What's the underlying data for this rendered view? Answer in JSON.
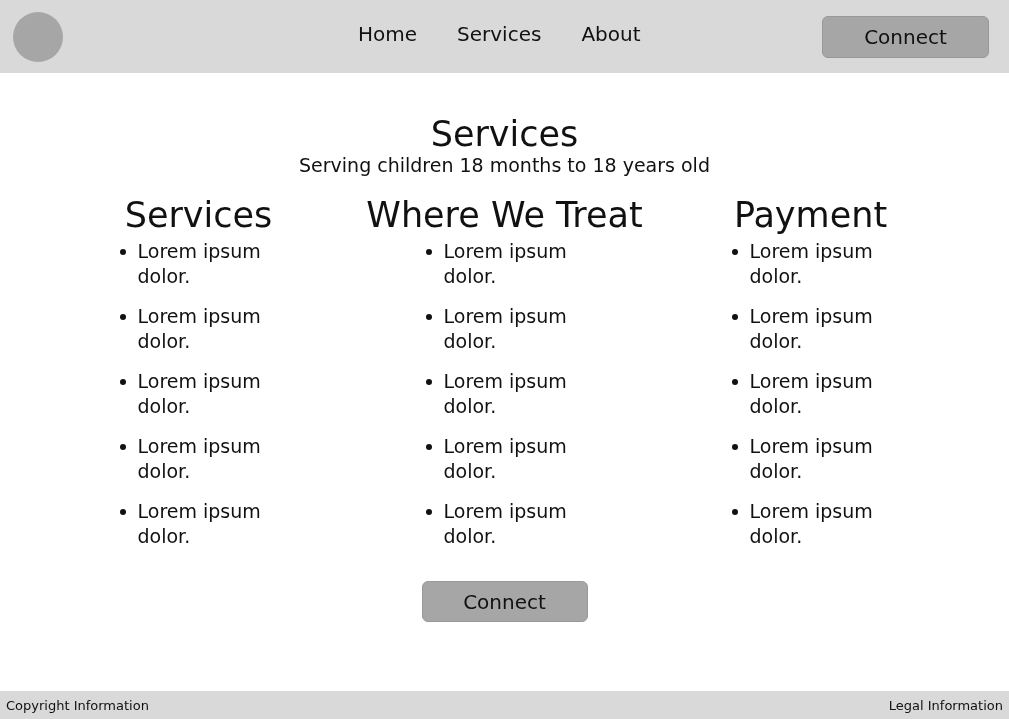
{
  "header": {
    "nav": [
      {
        "label": "Home"
      },
      {
        "label": "Services"
      },
      {
        "label": "About"
      }
    ],
    "button": "Connect"
  },
  "hero": {
    "title": "Services",
    "subtitle": "Serving children 18 months to 18 years old"
  },
  "columns": [
    {
      "title": "Services",
      "items": [
        "Lorem ipsum dolor.",
        "Lorem ipsum dolor.",
        "Lorem ipsum dolor.",
        "Lorem ipsum dolor.",
        "Lorem ipsum dolor."
      ]
    },
    {
      "title": "Where We Treat",
      "items": [
        "Lorem ipsum dolor.",
        "Lorem ipsum dolor.",
        "Lorem ipsum dolor.",
        "Lorem ipsum dolor.",
        "Lorem ipsum dolor."
      ]
    },
    {
      "title": "Payment",
      "items": [
        "Lorem ipsum dolor.",
        "Lorem ipsum dolor.",
        "Lorem ipsum dolor.",
        "Lorem ipsum dolor.",
        "Lorem ipsum dolor."
      ]
    }
  ],
  "cta": "Connect",
  "footer": {
    "left": "Copyright Information",
    "right": "Legal Information"
  }
}
